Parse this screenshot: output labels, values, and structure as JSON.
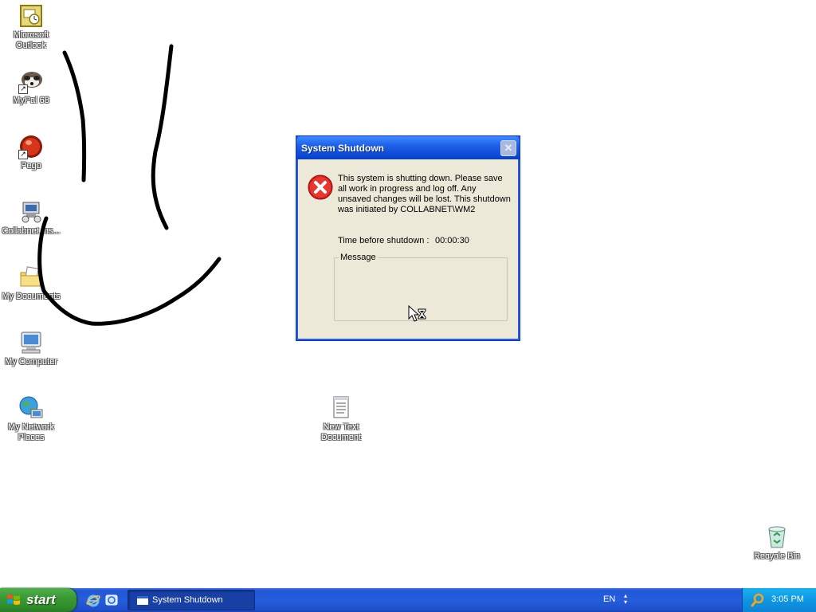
{
  "desktop": {
    "icons": [
      {
        "label": "Microsoft Outlook"
      },
      {
        "label": "MyPal 68"
      },
      {
        "label": "Pego"
      },
      {
        "label": "Collabnet Ins..."
      },
      {
        "label": "My Documents"
      },
      {
        "label": "My Computer"
      },
      {
        "label": "My Network Places"
      },
      {
        "label": "New Text Document"
      },
      {
        "label": "Recycle Bin"
      }
    ]
  },
  "dialog": {
    "title": "System Shutdown",
    "close_label": "✕",
    "message": "This system is shutting down. Please save all work in progress and log off. Any unsaved changes will be lost. This shutdown was initiated by COLLABNET\\WM2",
    "timer_label": "Time before shutdown :",
    "timer_value": "00:00:30",
    "message_group_label": "Message",
    "message_group_text": ""
  },
  "taskbar": {
    "start_label": "start",
    "task_button_label": "System Shutdown",
    "language": "EN",
    "clock": "3:05 PM"
  },
  "colors": {
    "titlebar": "#0b48d6",
    "start_green": "#3a9a35",
    "taskbar_blue": "#245edb",
    "tray_blue": "#0f96e4"
  }
}
